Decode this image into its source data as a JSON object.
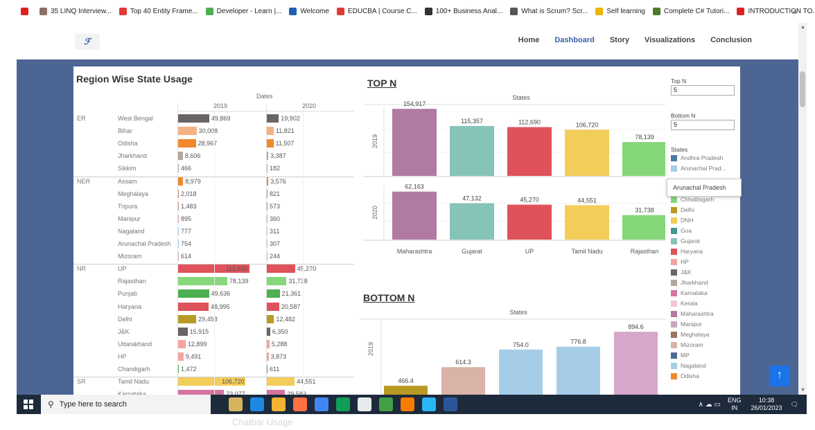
{
  "bookmarks": [
    {
      "label": "",
      "color": "#e02020"
    },
    {
      "label": "35 LINQ Interview...",
      "color": "#8d6e63"
    },
    {
      "label": "Top 40 Entity Frame...",
      "color": "#e53935"
    },
    {
      "label": "Developer - Learn |...",
      "color": "#4caf50"
    },
    {
      "label": "Welcome",
      "color": "#1e5fb4"
    },
    {
      "label": "EDUCBA | Course C...",
      "color": "#e53935"
    },
    {
      "label": "100+ Business Anal...",
      "color": "#333333"
    },
    {
      "label": "What is Scrum? Scr...",
      "color": "#555555"
    },
    {
      "label": "Self learning",
      "color": "#f0b400"
    },
    {
      "label": "Complete C# Tutori...",
      "color": "#4a7a2a"
    },
    {
      "label": "INTRODUCTION TO...",
      "color": "#e02020"
    }
  ],
  "bookmarks_more": "»",
  "nav": {
    "logo_text": "ℱ",
    "links": [
      "Home",
      "Dashboard",
      "Story",
      "Visualizations",
      "Conclusion"
    ],
    "active": "Dashboard"
  },
  "table": {
    "title": "Region Wise State Usage",
    "header": "Dates",
    "years": [
      "2019",
      "2020"
    ],
    "max_value": 154917,
    "regions": [
      {
        "name": "ER",
        "rows": [
          {
            "state": "West Bengal",
            "v2019": "49,869",
            "v2020": "19,902",
            "color": "#6b6464",
            "n2019": 49869,
            "n2020": 19902
          },
          {
            "state": "Bihar",
            "v2019": "30,008",
            "v2020": "11,821",
            "color": "#f4b183",
            "n2019": 30008,
            "n2020": 11821
          },
          {
            "state": "Odisha",
            "v2019": "28,967",
            "v2020": "11,507",
            "color": "#f0892c",
            "n2019": 28967,
            "n2020": 11507
          },
          {
            "state": "Jharkhand",
            "v2019": "8,606",
            "v2020": "3,387",
            "color": "#b0a79f",
            "n2019": 8606,
            "n2020": 3387
          },
          {
            "state": "Sikkim",
            "v2019": "466",
            "v2020": "182",
            "color": "#b0a79f",
            "n2019": 466,
            "n2020": 182
          }
        ]
      },
      {
        "name": "NER",
        "rows": [
          {
            "state": "Assam",
            "v2019": "8,979",
            "v2020": "3,576",
            "color": "#f0892c",
            "n2019": 8979,
            "n2020": 3576
          },
          {
            "state": "Meghalaya",
            "v2019": "2,018",
            "v2020": "821",
            "color": "#b68b7a",
            "n2019": 2018,
            "n2020": 821
          },
          {
            "state": "Tripura",
            "v2019": "1,483",
            "v2020": "573",
            "color": "#b68b7a",
            "n2019": 1483,
            "n2020": 573
          },
          {
            "state": "Manipur",
            "v2019": "895",
            "v2020": "360",
            "color": "#c9a5c4",
            "n2019": 895,
            "n2020": 360
          },
          {
            "state": "Nagaland",
            "v2019": "777",
            "v2020": "311",
            "color": "#a6cde8",
            "n2019": 777,
            "n2020": 311
          },
          {
            "state": "Arunachal Pradesh",
            "v2019": "754",
            "v2020": "307",
            "color": "#a6cde8",
            "n2019": 754,
            "n2020": 307
          },
          {
            "state": "Mizoram",
            "v2019": "614",
            "v2020": "244",
            "color": "#d9b3a8",
            "n2019": 614,
            "n2020": 244
          }
        ]
      },
      {
        "name": "NR",
        "rows": [
          {
            "state": "UP",
            "v2019": "112,690",
            "v2020": "45,270",
            "color": "#e0525b",
            "n2019": 112690,
            "n2020": 45270
          },
          {
            "state": "Rajasthan",
            "v2019": "78,139",
            "v2020": "31,738",
            "color": "#86d67a",
            "n2019": 78139,
            "n2020": 31738
          },
          {
            "state": "Punjab",
            "v2019": "49,636",
            "v2020": "21,361",
            "color": "#4caf50",
            "n2019": 49636,
            "n2020": 21361
          },
          {
            "state": "Haryana",
            "v2019": "48,995",
            "v2020": "20,587",
            "color": "#e0525b",
            "n2019": 48995,
            "n2020": 20587
          },
          {
            "state": "Delhi",
            "v2019": "29,458",
            "v2020": "12,482",
            "color": "#b89a24",
            "n2019": 29458,
            "n2020": 12482
          },
          {
            "state": "J&K",
            "v2019": "15,915",
            "v2020": "6,350",
            "color": "#6b6464",
            "n2019": 15915,
            "n2020": 6350
          },
          {
            "state": "Uttarakhand",
            "v2019": "12,899",
            "v2020": "5,288",
            "color": "#f4a3a3",
            "n2019": 12899,
            "n2020": 5288
          },
          {
            "state": "HP",
            "v2019": "9,491",
            "v2020": "3,873",
            "color": "#f4a3a3",
            "n2019": 9491,
            "n2020": 3873
          },
          {
            "state": "Chandigarh",
            "v2019": "1,472",
            "v2020": "611",
            "color": "#4caf50",
            "n2019": 1472,
            "n2020": 611
          }
        ]
      },
      {
        "name": "SR",
        "rows": [
          {
            "state": "Tamil Nadu",
            "v2019": "106,720",
            "v2020": "44,551",
            "color": "#f3cd5a",
            "n2019": 106720,
            "n2020": 44551
          },
          {
            "state": "Karnataka",
            "v2019": "73,077",
            "v2020": "29,589",
            "color": "#d3759e",
            "n2019": 73077,
            "n2020": 29589
          }
        ]
      }
    ]
  },
  "chart_data": [
    {
      "type": "bar",
      "title": "TOP N",
      "axis_title": "States",
      "categories": [
        "Maharashtra",
        "Gujarat",
        "UP",
        "Tamil Nadu",
        "Rajasthan"
      ],
      "colors": [
        "#b07aa1",
        "#86c4b9",
        "#e0525b",
        "#f3cd5a",
        "#86d67a"
      ],
      "series": [
        {
          "name": "2019",
          "values": [
            154917,
            115357,
            112690,
            106720,
            78139
          ],
          "labels": [
            "154,917",
            "115,357",
            "112,690",
            "106,720",
            "78,139"
          ]
        },
        {
          "name": "2020",
          "values": [
            62163,
            47132,
            45270,
            44551,
            31738
          ],
          "labels": [
            "62,163",
            "47,132",
            "45,270",
            "44,551",
            "31,738"
          ]
        }
      ],
      "ylim_2019": [
        0,
        160000
      ],
      "ylim_2020": [
        0,
        70000
      ],
      "grid": true
    },
    {
      "type": "bar",
      "title": "BOTTOM N",
      "axis_title": "States",
      "categories": [
        "",
        "",
        "",
        "",
        ""
      ],
      "colors": [
        "#b89a24",
        "#d9b3a8",
        "#a6cde8",
        "#a6cde8",
        "#d7a6c9"
      ],
      "series": [
        {
          "name": "2019",
          "values": [
            466.4,
            614.3,
            754.0,
            776.8,
            894.6
          ],
          "labels": [
            "466.4",
            "614.3",
            "754.0",
            "776.8",
            "894.6"
          ]
        }
      ],
      "ylim": [
        0,
        1000
      ],
      "grid": true
    }
  ],
  "filters": {
    "top_label": "Top N",
    "top_value": "5",
    "bottom_label": "Bottom N",
    "bottom_value": "5",
    "legend_title": "States",
    "legend": [
      {
        "name": "Andhra Pradesh",
        "color": "#4e79a7"
      },
      {
        "name": "Arunachal Prad...",
        "color": "#a6cde8"
      },
      {
        "name": "Chandigarh",
        "color": "#4caf50"
      },
      {
        "name": "Chhattisgarh",
        "color": "#86d67a"
      },
      {
        "name": "Delhi",
        "color": "#b89a24"
      },
      {
        "name": "DNH",
        "color": "#f3cd5a"
      },
      {
        "name": "Goa",
        "color": "#3e9c8f"
      },
      {
        "name": "Gujarat",
        "color": "#86c4b9"
      },
      {
        "name": "Haryana",
        "color": "#e0525b"
      },
      {
        "name": "HP",
        "color": "#f4a3a3"
      },
      {
        "name": "J&K",
        "color": "#6b6464"
      },
      {
        "name": "Jharkhand",
        "color": "#b0a79f"
      },
      {
        "name": "Karnataka",
        "color": "#d3759e"
      },
      {
        "name": "Kerala",
        "color": "#f7c0d4"
      },
      {
        "name": "Maharashtra",
        "color": "#b07aa1"
      },
      {
        "name": "Manipur",
        "color": "#c9a5c4"
      },
      {
        "name": "Meghalaya",
        "color": "#9c755f"
      },
      {
        "name": "Mizoram",
        "color": "#d9b3a8"
      },
      {
        "name": "MP",
        "color": "#4e6a91"
      },
      {
        "name": "Nagaland",
        "color": "#a6cde8"
      },
      {
        "name": "Odisha",
        "color": "#f0892c"
      }
    ],
    "tooltip": "Arunachal Pradesh"
  },
  "fab": "↑",
  "taskbar": {
    "search_placeholder": "Type here to search",
    "lang_line1": "ENG",
    "lang_line2": "IN",
    "time": "10:38",
    "date": "26/01/2023",
    "tray_icons": "∧ ☁ ▭",
    "app_colors": [
      "#d6b35c",
      "#1e88e5",
      "#f2b233",
      "#ff7043",
      "#4285f4",
      "#0f9d58",
      "#e8eaed",
      "#43a047",
      "#f57c00",
      "#29b6f6",
      "#2b579a"
    ]
  },
  "bleed_text": "Chatbar Usage"
}
